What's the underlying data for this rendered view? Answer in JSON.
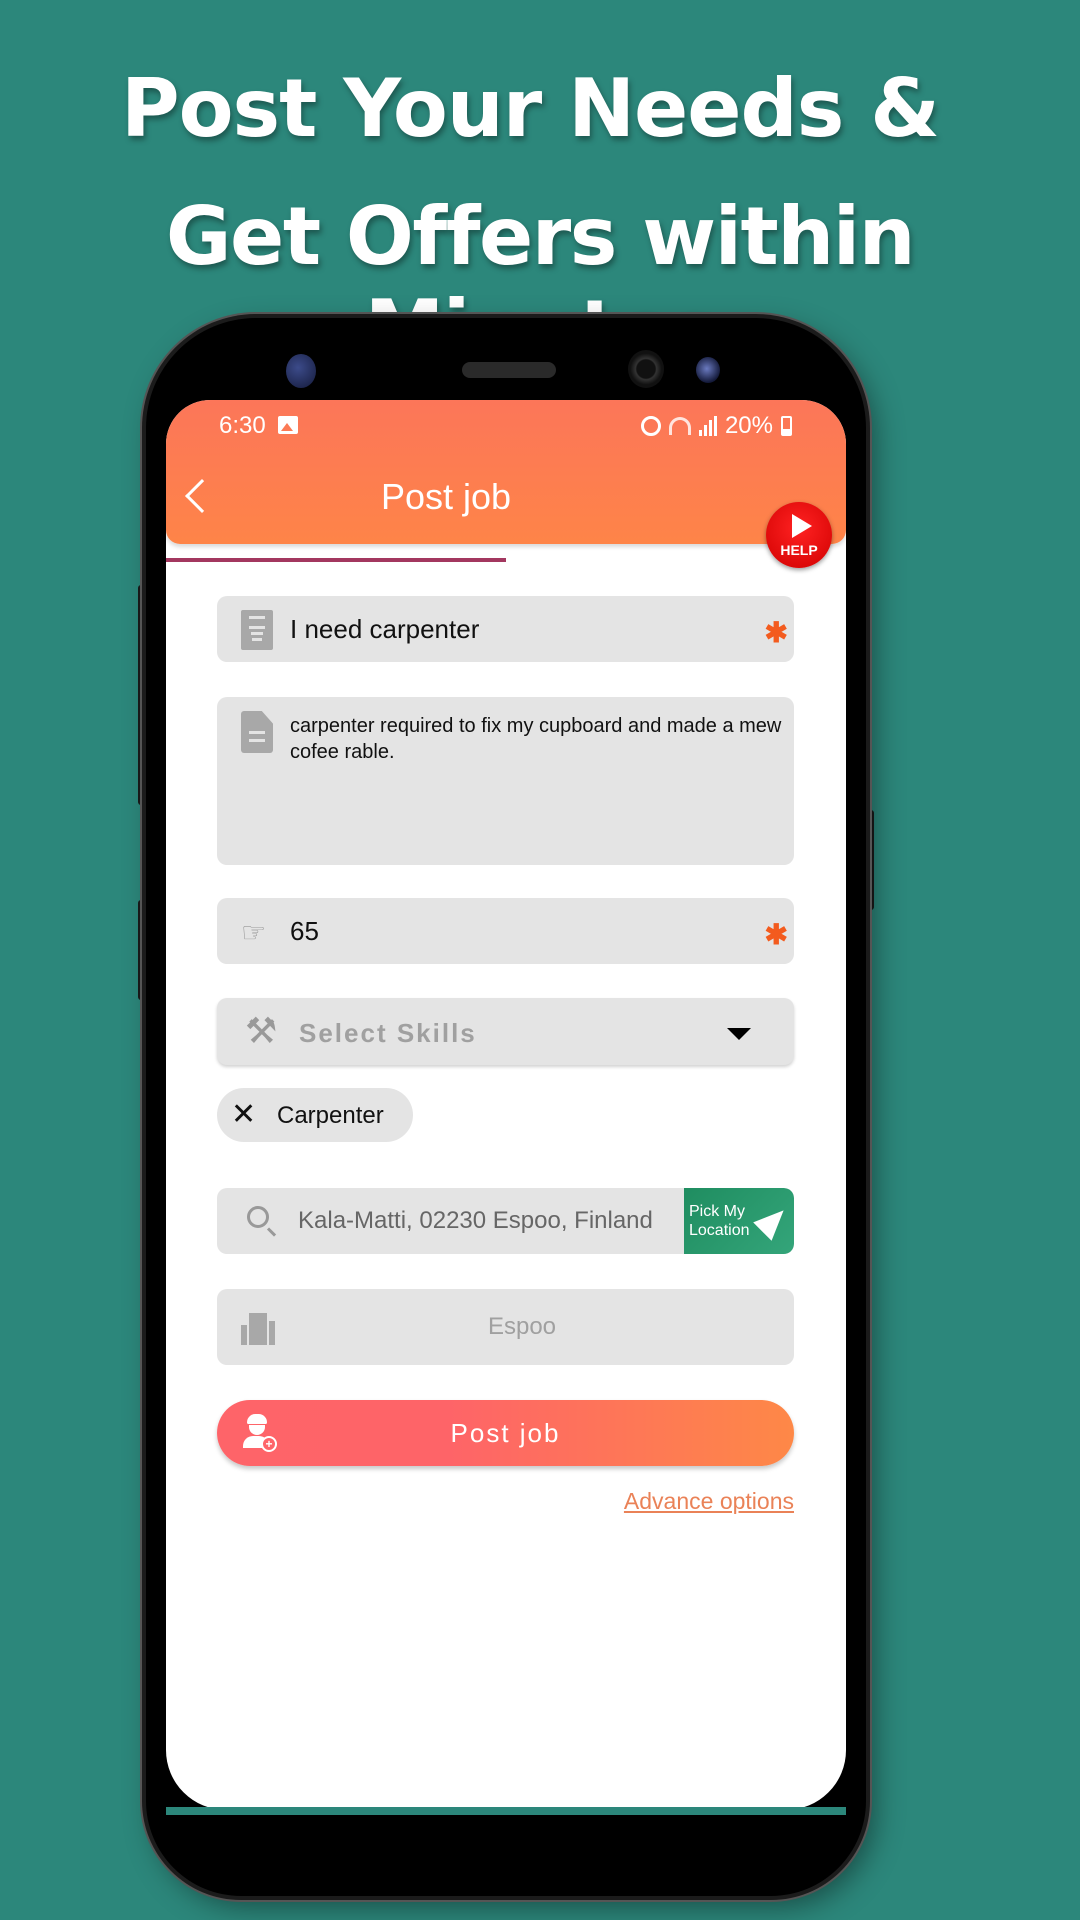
{
  "promo": {
    "headline_line1": "Post Your Needs &",
    "headline_line2": "Get Offers within Minutes"
  },
  "status_bar": {
    "time": "6:30",
    "battery": "20%",
    "icons": [
      "image-icon",
      "alarm-icon",
      "wifi-icon",
      "signal-icon",
      "battery-icon"
    ]
  },
  "app_bar": {
    "title": "Post job",
    "back_icon": "chevron-left-icon",
    "help_label": "HELP"
  },
  "progress": {
    "value": 0.5
  },
  "form": {
    "title": {
      "value": "I need carpenter",
      "required_mark": "✱",
      "icon": "notes-icon"
    },
    "description": {
      "value": "carpenter required to fix my cupboard and made a mew cofee rable.",
      "icon": "document-icon"
    },
    "budget": {
      "value": "65",
      "required_mark": "✱",
      "icon": "euro-hand-icon",
      "icon_glyph": "☞"
    },
    "skills": {
      "placeholder": "Select Skills",
      "icon": "tools-icon",
      "icon_glyph": "⚒"
    },
    "selected_skills": [
      {
        "label": "Carpenter",
        "remove_glyph": "✕"
      }
    ],
    "location": {
      "value": "Kala-Matti, 02230 Espoo, Finland",
      "pick_button_label": "Pick My Location",
      "pick_line1": "Pick My",
      "pick_line2": "Location"
    },
    "city": {
      "value": "Espoo",
      "icon": "building-icon"
    },
    "submit_label": "Post job",
    "advance_options_label": "Advance options"
  },
  "colors": {
    "background": "#2c877b",
    "app_bar_start": "#fc7659",
    "app_bar_end": "#fe8448",
    "progress": "#a3375f",
    "required": "#f35b1e",
    "pick_location": "#1f8d60",
    "post_button_start": "#fe6469",
    "post_button_end": "#fe8847",
    "link": "#ea8257",
    "help": "#e00000"
  }
}
